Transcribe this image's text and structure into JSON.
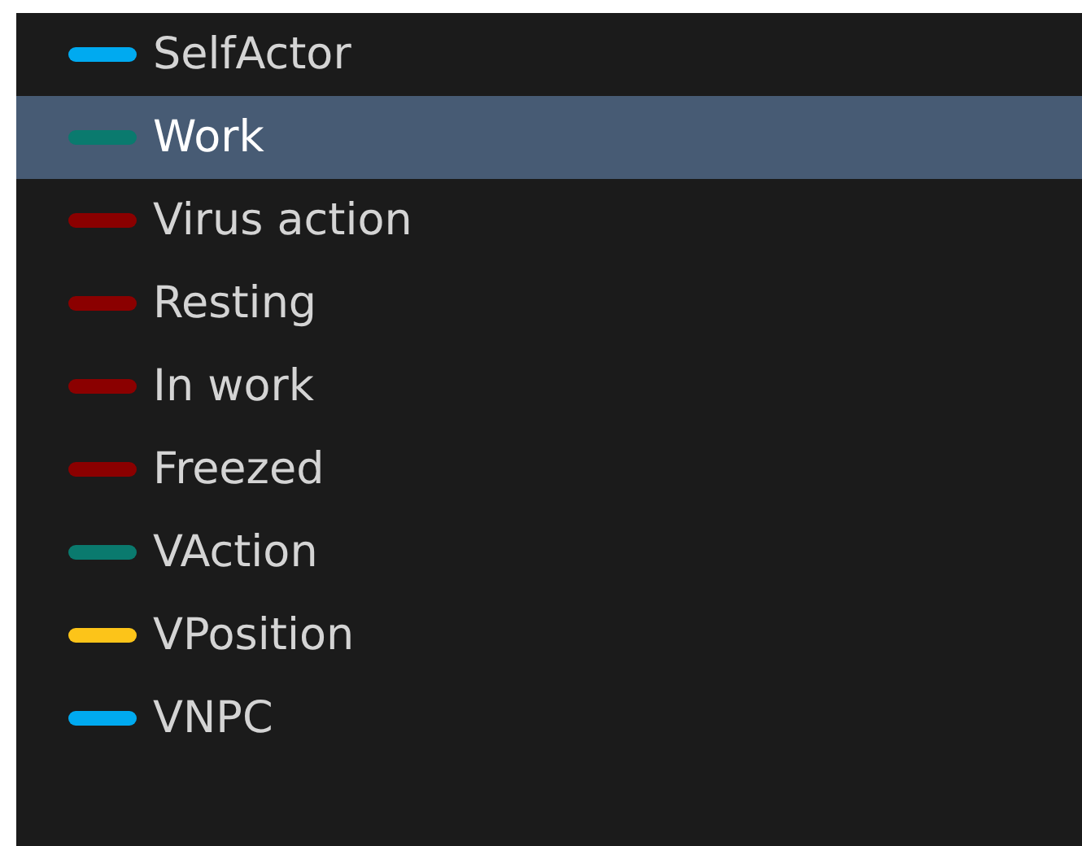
{
  "items": [
    {
      "label": "SelfActor",
      "color": "#00aaf0",
      "selected": false
    },
    {
      "label": "Work",
      "color": "#0a7a6e",
      "selected": true
    },
    {
      "label": "Virus action",
      "color": "#8b0000",
      "selected": false
    },
    {
      "label": "Resting",
      "color": "#8b0000",
      "selected": false
    },
    {
      "label": "In work",
      "color": "#8b0000",
      "selected": false
    },
    {
      "label": "Freezed",
      "color": "#8b0000",
      "selected": false
    },
    {
      "label": "VAction",
      "color": "#0a7a6e",
      "selected": false
    },
    {
      "label": "VPosition",
      "color": "#fcc419",
      "selected": false
    },
    {
      "label": "VNPC",
      "color": "#00aaf0",
      "selected": false
    }
  ]
}
